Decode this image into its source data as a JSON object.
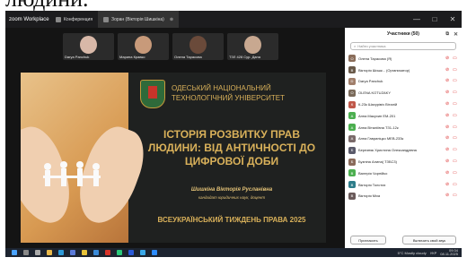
{
  "caption": "людини.",
  "titlebar": {
    "app_name": "zoom Workplace",
    "tabs": [
      {
        "label": "Конференция"
      },
      {
        "label": "Зоран (Вікторія Шишкіна)"
      }
    ],
    "controls": [
      "—",
      "□",
      "✕"
    ]
  },
  "thumbnails": [
    {
      "name": "Darya Panchuk"
    },
    {
      "name": "Марина Кравко"
    },
    {
      "name": "Олена Тарасова"
    },
    {
      "name": "ТЗЛ 428 Сур. Дана"
    }
  ],
  "slide": {
    "university": "ОДЕСЬКИЙ НАЦІОНАЛЬНИЙ ТЕХНОЛОГІЧНИЙ УНІВЕРСИТЕТ",
    "title": "ІСТОРІЯ РОЗВИТКУ ПРАВ ЛЮДИНИ: ВІД АНТИЧНОСТІ ДО ЦИФРОВОЇ ДОБИ",
    "author": "Шишкіна Вікторія Русланівна",
    "author_role": "кандидат юридичних наук, доцент",
    "event": "ВСЕУКРАЇНСЬКИЙ ТИЖДЕНЬ ПРАВА 2025"
  },
  "participants_panel": {
    "title": "Участники (50)",
    "search_placeholder": "Найти участника",
    "participants": [
      {
        "name": "Олена Тарасова (Я)",
        "color": "#8a6d5a",
        "initial": "О"
      },
      {
        "name": "Вікторія Шишк... (Организатор)",
        "color": "#6a5a4a",
        "initial": "В"
      },
      {
        "name": "Darya Panchuk",
        "color": "#a07e6a",
        "initial": "D"
      },
      {
        "name": "OLENA KOTUZAKY",
        "color": "#7a6a5a",
        "initial": "O"
      },
      {
        "name": "К-23к Шахурівіч Віталій",
        "color": "#c0584a",
        "initial": "К"
      },
      {
        "name": "Анна Макухин ЕМ-201",
        "color": "#4caf50",
        "initial": "А"
      },
      {
        "name": "Анна Віталіївна ТЗ1-12к",
        "color": "#4caf50",
        "initial": "А"
      },
      {
        "name": "Анна Гавриліцко МЕВ-233к",
        "color": "#7a6a6a",
        "initial": "А"
      },
      {
        "name": "Березняк Христина Олександрівна",
        "color": "#5a5a6a",
        "initial": "Б"
      },
      {
        "name": "Бузніна Алина( ТЗБС3)",
        "color": "#8a6a5a",
        "initial": "Б"
      },
      {
        "name": "Валерія Чорнійко",
        "color": "#4caf50",
        "initial": "В"
      },
      {
        "name": "Вікторія Толстих",
        "color": "#2e7d8a",
        "initial": "В"
      },
      {
        "name": "Вікторія Міха",
        "color": "#6a5a5a",
        "initial": "В"
      }
    ],
    "invite_button": "Пригласить",
    "mute_button": "Включить свой звук"
  },
  "taskbar": {
    "weather": "5°C Mostly cloudy",
    "language": "УКР",
    "time": "09:34",
    "date": "08.11.2025"
  }
}
